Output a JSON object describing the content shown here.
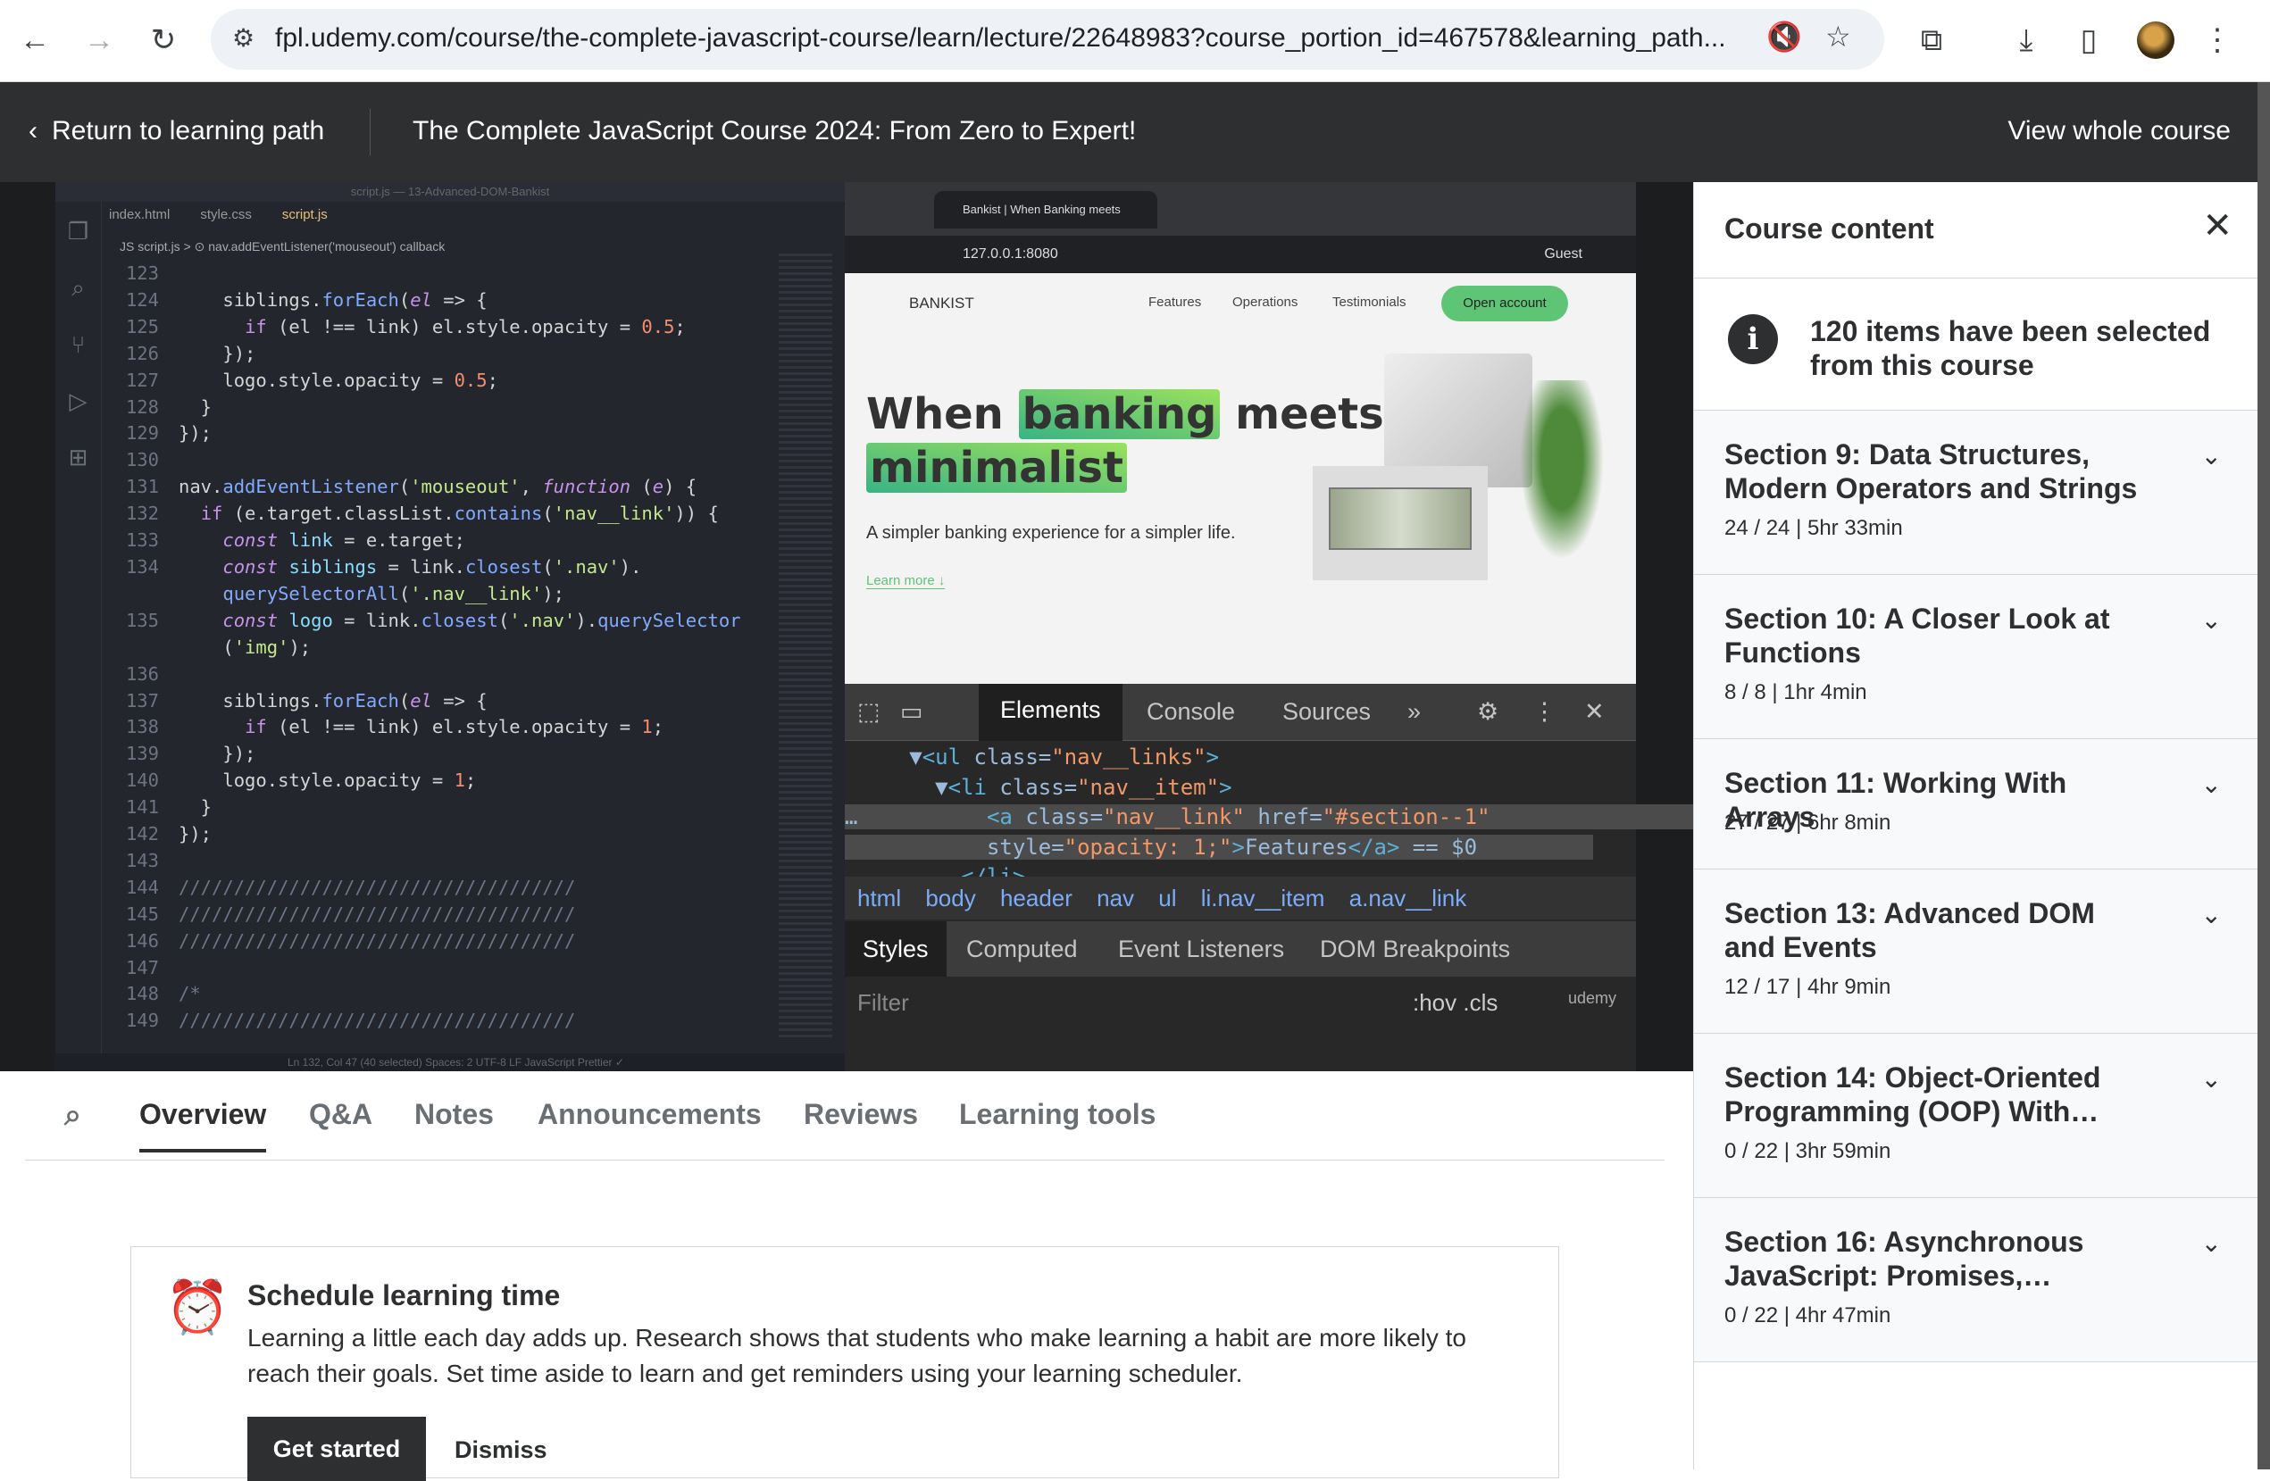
{
  "browser": {
    "url": "fpl.udemy.com/course/the-complete-javascript-course/learn/lecture/22648983?course_portion_id=467578&learning_path..."
  },
  "header": {
    "return_label": "Return to learning path",
    "course_title": "The Complete JavaScript Course 2024: From Zero to Expert!",
    "view_whole": "View whole course"
  },
  "video": {
    "vscode": {
      "window_title": "script.js — 13-Advanced-DOM-Bankist",
      "tabs": [
        "index.html",
        "style.css",
        "script.js"
      ],
      "breadcrumb": "JS script.js > ⊙ nav.addEventListener('mouseout') callback",
      "status": "Ln 132, Col 47 (40 selected)   Spaces: 2   UTF-8   LF   JavaScript   Prettier ✓"
    },
    "bankist": {
      "tab_title": "Bankist | When Banking meets",
      "address": "127.0.0.1:8080",
      "guest": "Guest",
      "logo": "BANKIST",
      "nav": [
        "Features",
        "Operations",
        "Testimonials"
      ],
      "open_account": "Open account",
      "hero_1": "When",
      "hero_hl1": "banking",
      "hero_2": "meets",
      "hero_hl2": "minimalist",
      "subtitle": "A simpler banking experience for a simpler life.",
      "learn_more": "Learn more ↓"
    },
    "devtools": {
      "tabs": [
        "Elements",
        "Console",
        "Sources"
      ],
      "crumbs": "html body header nav ul li.nav__item a.nav__link",
      "style_tabs": [
        "Styles",
        "Computed",
        "Event Listeners",
        "DOM Breakpoints"
      ],
      "filter": "Filter",
      "hov": ":hov .cls",
      "watermark": "udemy"
    }
  },
  "tabs": [
    "Overview",
    "Q&A",
    "Notes",
    "Announcements",
    "Reviews",
    "Learning tools"
  ],
  "card": {
    "title": "Schedule learning time",
    "text": "Learning a little each day adds up. Research shows that students who make learning a habit are more likely to reach their goals. Set time aside to learn and get reminders using your learning scheduler.",
    "get_started": "Get started",
    "dismiss": "Dismiss"
  },
  "sidebar": {
    "title": "Course content",
    "info": "120 items have been selected from this course",
    "sections": [
      {
        "title": "Section 9: Data Structures, Modern Operators and Strings",
        "meta": "24 / 24 | 5hr 33min"
      },
      {
        "title": "Section 10: A Closer Look at Functions",
        "meta": "8 / 8 | 1hr 4min"
      },
      {
        "title": "Section 11: Working With Arrays",
        "meta": "27 / 27 | 6hr 8min"
      },
      {
        "title": "Section 13: Advanced DOM and Events",
        "meta": "12 / 17 | 4hr 9min"
      },
      {
        "title": "Section 14: Object-Oriented Programming (OOP) With…",
        "meta": "0 / 22 | 3hr 59min"
      },
      {
        "title": "Section 16: Asynchronous JavaScript: Promises,…",
        "meta": "0 / 22 | 4hr 47min"
      }
    ]
  }
}
